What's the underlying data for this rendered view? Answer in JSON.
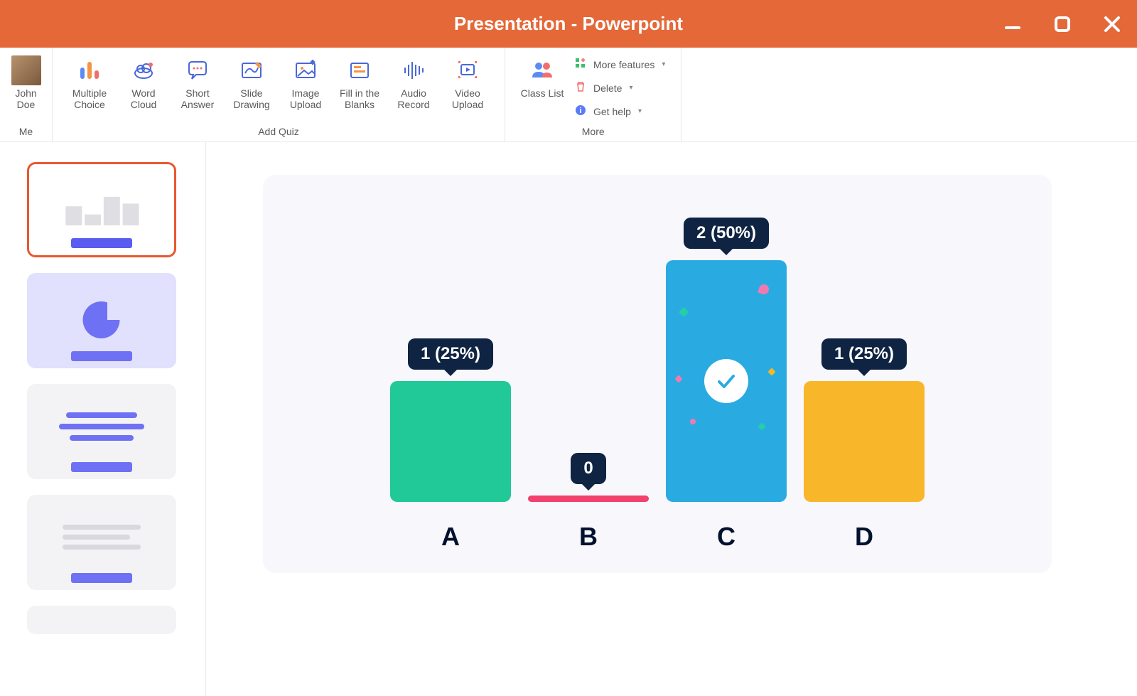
{
  "window": {
    "title": "Presentation - Powerpoint"
  },
  "user": {
    "name": "John\nDoe",
    "group_label": "Me"
  },
  "ribbon": {
    "add_quiz": {
      "label": "Add Quiz",
      "multiple_choice": "Multiple\nChoice",
      "word_cloud": "Word\nCloud",
      "short_answer": "Short\nAnswer",
      "slide_drawing": "Slide\nDrawing",
      "image_upload": "Image\nUpload",
      "fill_blanks": "Fill in the\nBlanks",
      "audio_record": "Audio\nRecord",
      "video_upload": "Video\nUpload"
    },
    "more": {
      "label": "More",
      "class_list": "Class List",
      "more_features": "More features",
      "delete": "Delete",
      "get_help": "Get help"
    }
  },
  "chart_data": {
    "type": "bar",
    "categories": [
      "A",
      "B",
      "C",
      "D"
    ],
    "values": [
      1,
      0,
      2,
      1
    ],
    "total": 4,
    "correct_index": 2,
    "bar_labels": [
      "1 (25%)",
      "0",
      "2 (50%)",
      "1 (25%)"
    ],
    "colors": [
      "#20c997",
      "#f1416c",
      "#29abe2",
      "#f8b62a"
    ]
  }
}
